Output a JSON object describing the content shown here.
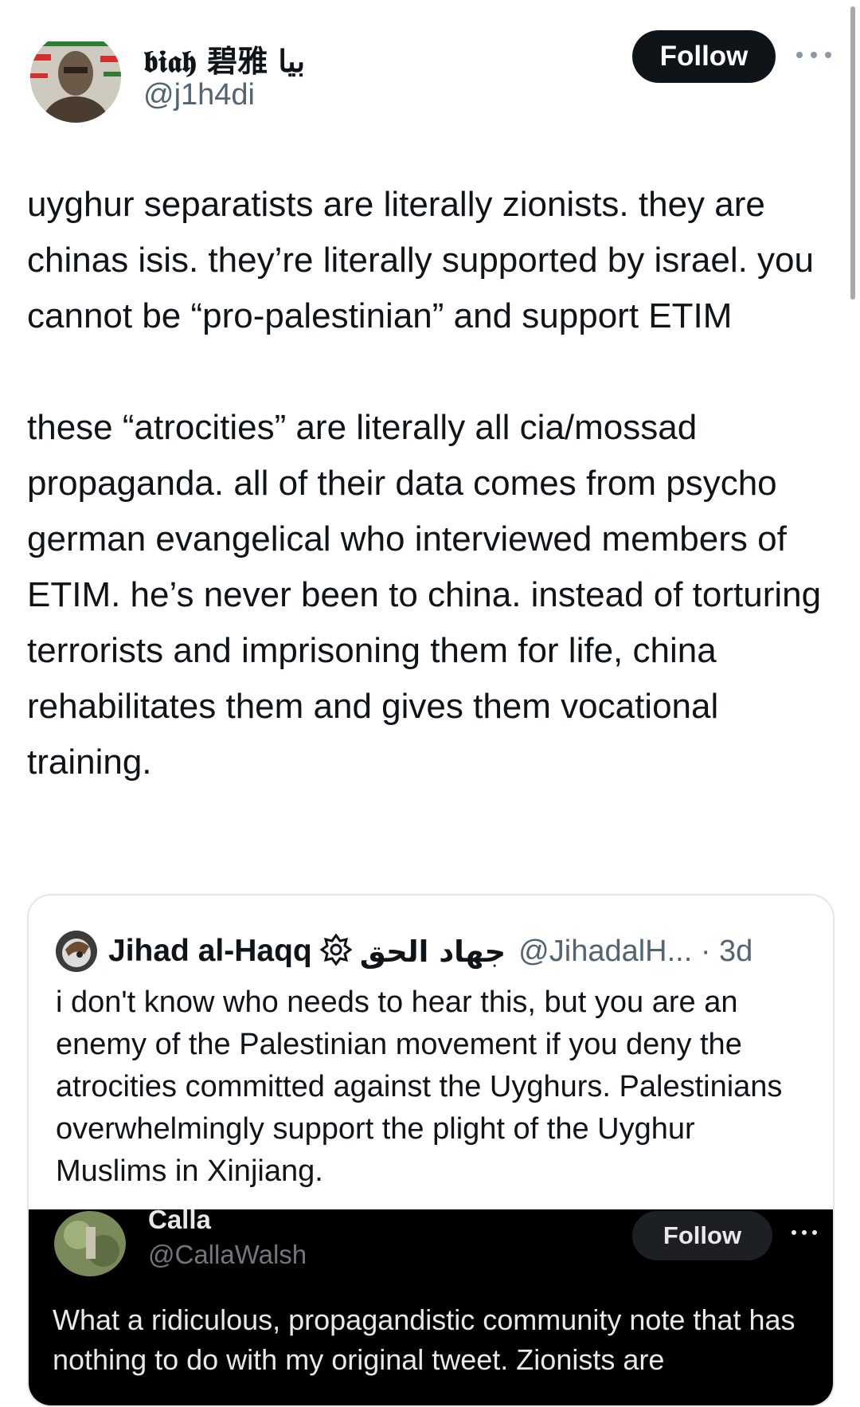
{
  "author": {
    "display_name": "𝖇𝖎𝖆𝖍 碧雅 بيا",
    "handle": "@j1h4di",
    "follow_label": "Follow",
    "avatar_icon": "avatar-photo-icon"
  },
  "tweet": {
    "paragraphs": [
      "uyghur separatists are literally zionists. they are chinas isis. they’re literally supported by israel. you cannot be “pro-palestinian” and support ETIM",
      "these “atrocities” are literally all cia/mossad propaganda. all of their data comes from psycho german evangelical who interviewed members of ETIM. he’s never been to china. instead of torturing terrorists and imprisoning them for life, china rehabilitates them and gives them vocational training."
    ]
  },
  "quoted_tweet": {
    "name": "Jihad al-Haqq",
    "name_arabic": "جهاد الحق",
    "handle_time": "@JihadalH... · 3d",
    "text": "i don't know who needs to hear this, but you are an enemy of the Palestinian movement if you deny the atrocities committed against the Uyghurs. Palestinians overwhelmingly support the plight of the Uyghur Muslims in Xinjiang.",
    "embedded": {
      "name": "Calla",
      "handle": "@CallaWalsh",
      "follow_label": "Follow",
      "text": "What a ridiculous, propagandistic community note that has nothing to do with my original tweet. Zionists are"
    }
  },
  "colors": {
    "text": "#0f1419",
    "secondary": "#536471",
    "follow_bg": "#0f1419",
    "embed_bg": "#000000"
  }
}
